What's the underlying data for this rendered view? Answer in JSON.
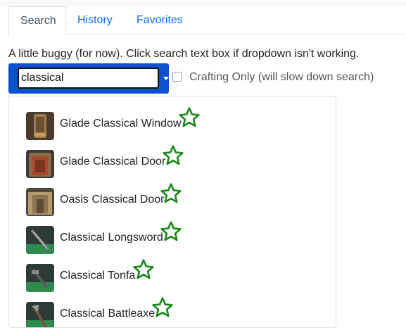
{
  "tabs": [
    {
      "label": "Search"
    },
    {
      "label": "History"
    },
    {
      "label": "Favorites"
    }
  ],
  "notice": "A little buggy (for now). Click search text box if dropdown isn't working.",
  "search": {
    "value": "classical"
  },
  "crafting_only": {
    "label": "Crafting Only (will slow down search)",
    "checked": false
  },
  "results": [
    {
      "label": "Glade Classical Window",
      "icon": "window-thumbnail"
    },
    {
      "label": "Glade Classical Door",
      "icon": "door-thumbnail"
    },
    {
      "label": "Oasis Classical Door",
      "icon": "door-thumbnail"
    },
    {
      "label": "Classical Longsword",
      "icon": "sword-thumbnail"
    },
    {
      "label": "Classical Tonfa",
      "icon": "tonfa-thumbnail"
    },
    {
      "label": "Classical Battleaxe",
      "icon": "axe-thumbnail"
    }
  ],
  "colors": {
    "accent": "#0d51d1",
    "link": "#0d6efd",
    "star": "#1e8a1e"
  }
}
